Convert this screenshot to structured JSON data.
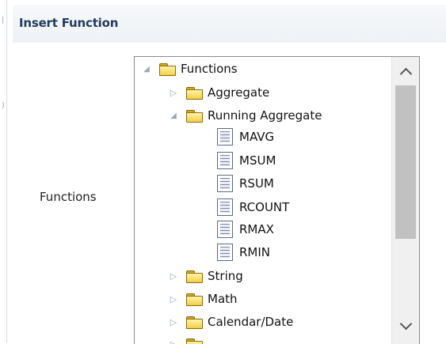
{
  "dialog": {
    "title": "Insert Function"
  },
  "form": {
    "functions_label": "Functions"
  },
  "tree": {
    "items": [
      {
        "label": "Functions",
        "type": "folder",
        "level": 0,
        "expanded": true
      },
      {
        "label": "Aggregate",
        "type": "folder",
        "level": 1,
        "expanded": false
      },
      {
        "label": "Running Aggregate",
        "type": "folder",
        "level": 1,
        "expanded": true
      },
      {
        "label": "MAVG",
        "type": "function",
        "level": 2
      },
      {
        "label": "MSUM",
        "type": "function",
        "level": 2
      },
      {
        "label": "RSUM",
        "type": "function",
        "level": 2
      },
      {
        "label": "RCOUNT",
        "type": "function",
        "level": 2
      },
      {
        "label": "RMAX",
        "type": "function",
        "level": 2
      },
      {
        "label": "RMIN",
        "type": "function",
        "level": 2
      },
      {
        "label": "String",
        "type": "folder",
        "level": 1,
        "expanded": false
      },
      {
        "label": "Math",
        "type": "folder",
        "level": 1,
        "expanded": false
      },
      {
        "label": "Calendar/Date",
        "type": "folder",
        "level": 1,
        "expanded": false
      }
    ]
  },
  "colors": {
    "title_text": "#1f3c5f",
    "folder_fill": "#f2cf46",
    "scroll_thumb": "#c1c1c1"
  }
}
